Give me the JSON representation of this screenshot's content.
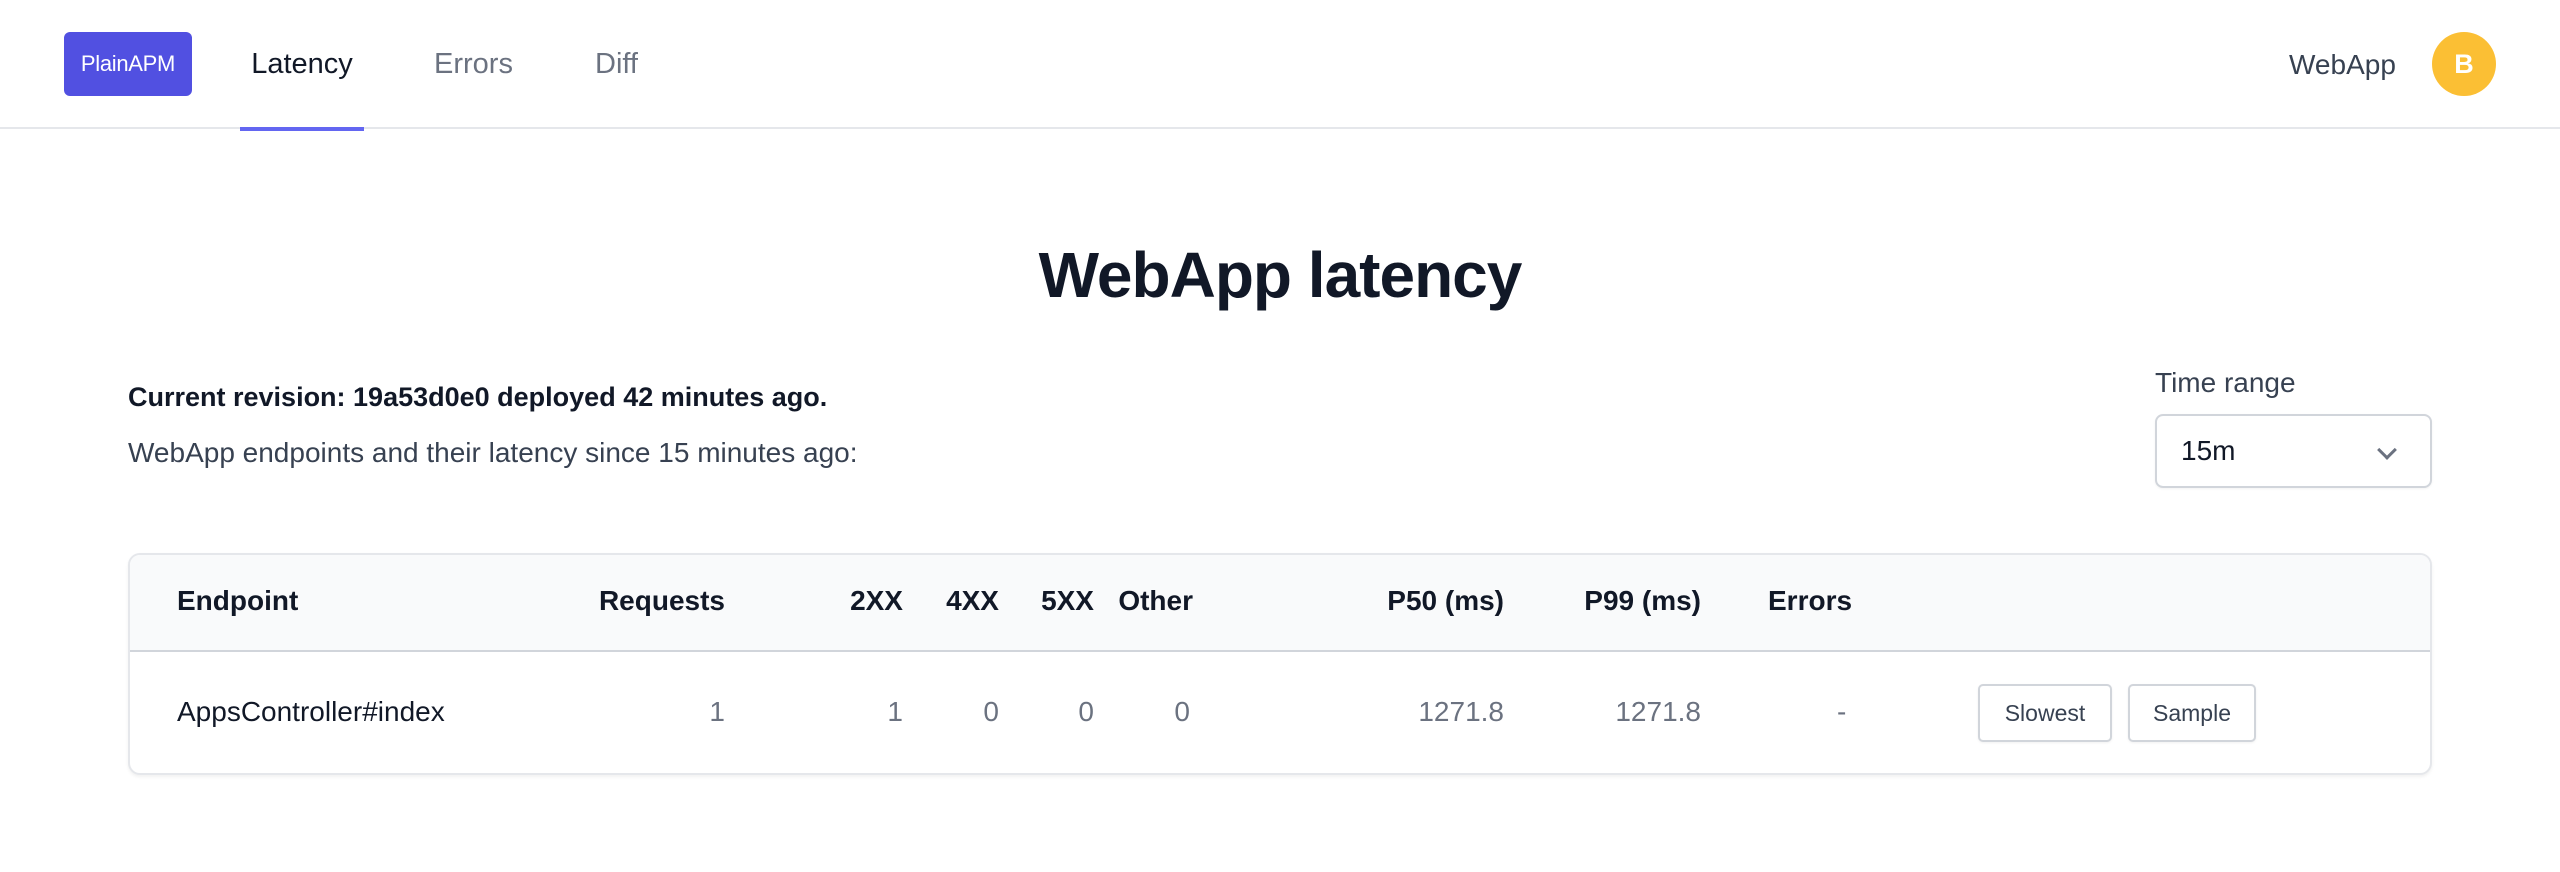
{
  "nav": {
    "logo": "PlainAPM",
    "tabs": [
      {
        "label": "Latency",
        "active": true
      },
      {
        "label": "Errors",
        "active": false
      },
      {
        "label": "Diff",
        "active": false
      }
    ],
    "app_name": "WebApp",
    "avatar_initial": "B"
  },
  "colors": {
    "brand": "#5150e1",
    "active_tab_underline": "#6366f1",
    "avatar": "#fbbf34"
  },
  "page": {
    "title": "WebApp latency",
    "revision_text": "Current revision: 19a53d0e0 deployed 42 minutes ago.",
    "description": "WebApp endpoints and their latency since 15 minutes ago:"
  },
  "time_range": {
    "label": "Time range",
    "selected": "15m"
  },
  "table": {
    "headers": {
      "endpoint": "Endpoint",
      "requests": "Requests",
      "s2xx": "2XX",
      "s4xx": "4XX",
      "s5xx": "5XX",
      "other": "Other",
      "p50": "P50 (ms)",
      "p99": "P99 (ms)",
      "errors": "Errors"
    },
    "rows": [
      {
        "endpoint": "AppsController#index",
        "requests": "1",
        "s2xx": "1",
        "s4xx": "0",
        "s5xx": "0",
        "other": "0",
        "p50": "1271.8",
        "p99": "1271.8",
        "errors": "-",
        "actions": {
          "slowest": "Slowest",
          "sample": "Sample"
        }
      }
    ]
  }
}
